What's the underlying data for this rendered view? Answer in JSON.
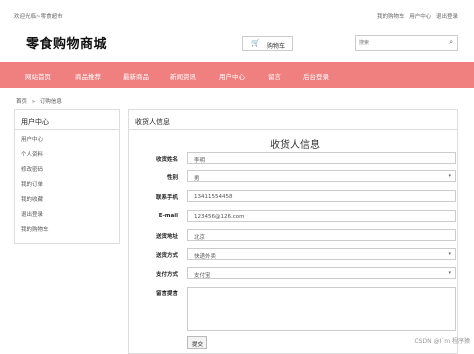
{
  "topbar": {
    "welcome": "欢迎光临~零食超市",
    "links": [
      "我的购物车",
      "用户中心",
      "退出登录"
    ]
  },
  "logo": "零食购物商城",
  "cart": {
    "icon": "cart-icon",
    "label": "购物车"
  },
  "search": {
    "placeholder": "搜索",
    "icon": "search-icon"
  },
  "nav": {
    "items": [
      "网站首页",
      "商品推荐",
      "最新商品",
      "新闻资讯",
      "用户中心",
      "留言",
      "后台登录"
    ]
  },
  "breadcrumb": [
    "首页",
    "»",
    "订购信息"
  ],
  "sidebar": {
    "title": "用户中心",
    "items": [
      "用户中心",
      "个人资料",
      "修改密码",
      "我的订单",
      "我的收藏",
      "退出登录",
      "我的购物车"
    ]
  },
  "main": {
    "title": "收货人信息",
    "form_title": "收货人信息"
  },
  "form": {
    "fields": [
      {
        "label": "收货姓名",
        "value": "李明"
      },
      {
        "label": "性别",
        "value": "男"
      },
      {
        "label": "联系手机",
        "value": "13411554458"
      },
      {
        "label": "E-mail",
        "value": "123456@126.com"
      },
      {
        "label": "送货地址",
        "value": "北京"
      },
      {
        "label": "送货方式",
        "value": "快递外卖"
      },
      {
        "label": "支付方式",
        "value": "支付宝"
      },
      {
        "label": "留言提言",
        "value": ""
      }
    ],
    "submit_label": "提交"
  },
  "watermark": "CSDN @I`m 程序猿"
}
